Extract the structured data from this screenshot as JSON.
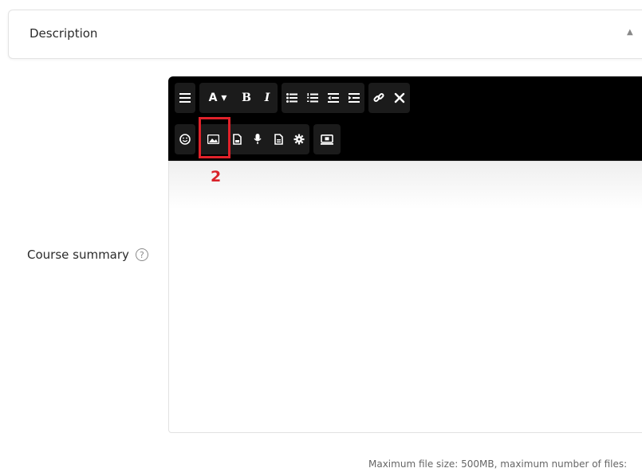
{
  "description_section": {
    "title": "Description",
    "toggle_icon": "caret-up-icon"
  },
  "field": {
    "label": "Course summary",
    "help_icon": "question-circle-icon",
    "help_glyph": "?"
  },
  "toolbar": {
    "row1": [
      [
        "menu-icon"
      ],
      [
        "font-style-icon",
        "bold-icon",
        "italic-icon"
      ],
      [
        "unordered-list-icon",
        "ordered-list-icon",
        "outdent-icon",
        "indent-icon"
      ],
      [
        "link-icon",
        "unlink-icon"
      ]
    ],
    "row2": [
      [
        "emoji-icon",
        "image-icon",
        "media-icon",
        "record-audio-icon",
        "manage-files-icon",
        "settings-icon",
        "screen-record-icon"
      ]
    ],
    "font_button_label": "A ▾",
    "bold_label": "B",
    "italic_label": "I"
  },
  "annotation": {
    "marker": "2",
    "highlight_color": "#e0222a"
  },
  "footer": {
    "file_limits": "Maximum file size: 500MB, maximum number of files:"
  }
}
